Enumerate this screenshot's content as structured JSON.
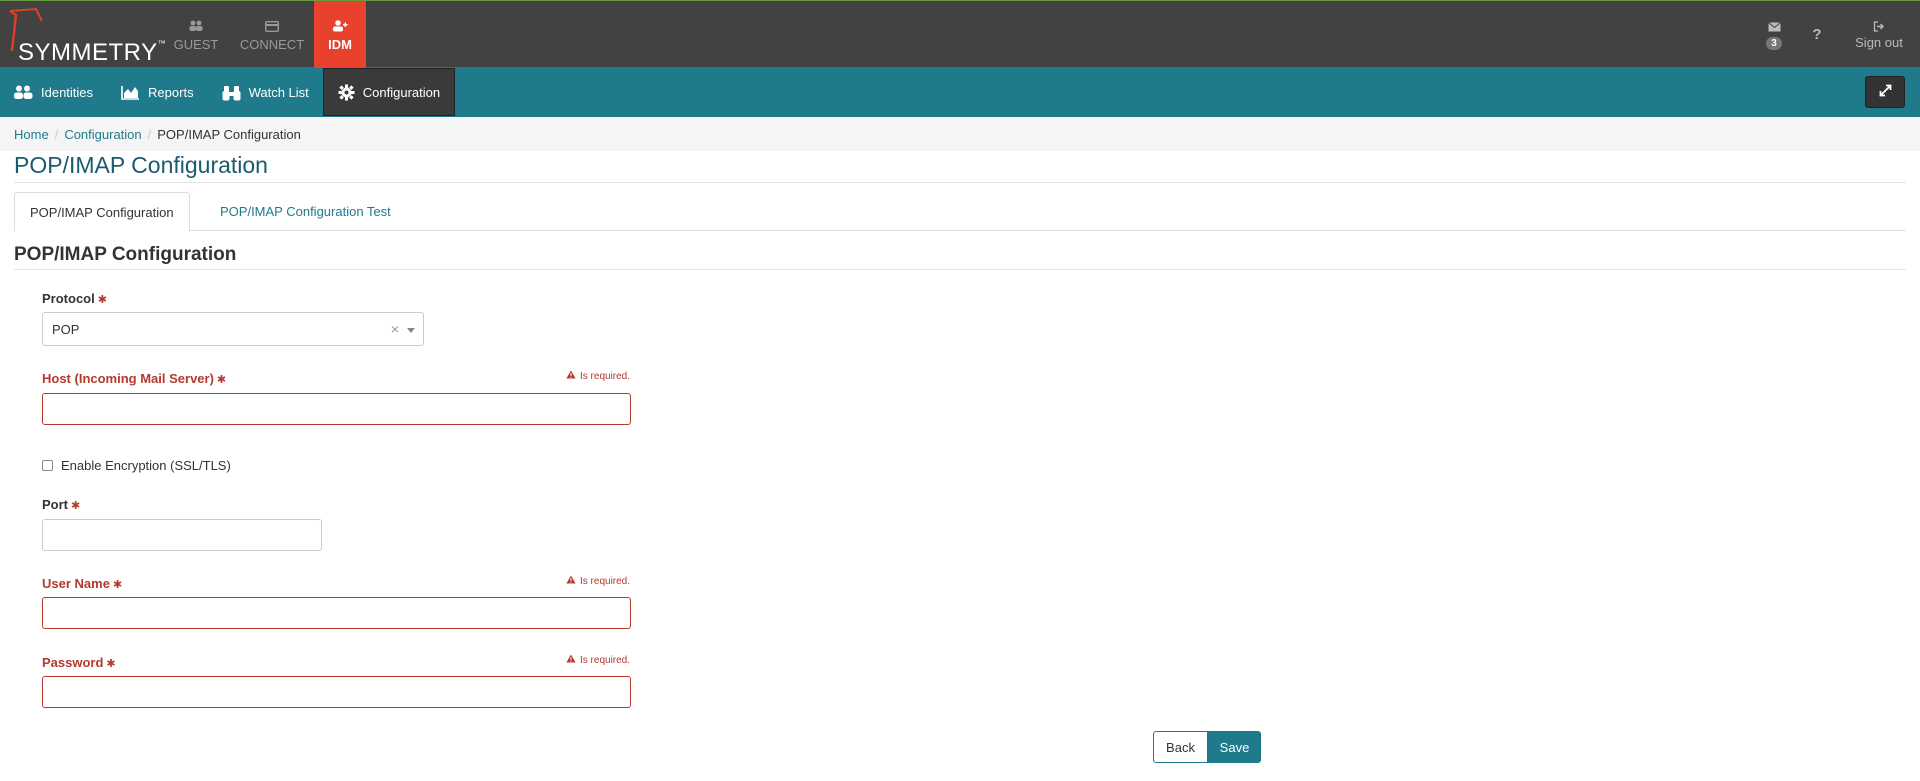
{
  "brand": {
    "name": "SYMMETRY",
    "tm": "™"
  },
  "topnav": {
    "guest": "GUEST",
    "connect": "CONNECT",
    "idm": "IDM"
  },
  "topright": {
    "mail_count": "3",
    "help": "?",
    "signout": "Sign out"
  },
  "subnav": {
    "identities": "Identities",
    "reports": "Reports",
    "watchlist": "Watch List",
    "configuration": "Configuration"
  },
  "breadcrumb": {
    "home": "Home",
    "configuration": "Configuration",
    "current": "POP/IMAP Configuration"
  },
  "page_title": "POP/IMAP Configuration",
  "tabs": {
    "config": "POP/IMAP Configuration",
    "test": "POP/IMAP Configuration Test"
  },
  "section_title": "POP/IMAP Configuration",
  "form": {
    "protocol_label": "Protocol",
    "protocol_value": "POP",
    "host_label": "Host (Incoming Mail Server)",
    "required_msg": "Is required.",
    "encryption_label": "Enable Encryption (SSL/TLS)",
    "port_label": "Port",
    "username_label": "User Name",
    "password_label": "Password",
    "asterisk": "✱",
    "clear": "×"
  },
  "buttons": {
    "back": "Back",
    "save": "Save"
  },
  "colors": {
    "topbar": "#424242",
    "accent_red": "#e8412d",
    "teal": "#1f7a8c",
    "error": "#b33a2e"
  }
}
